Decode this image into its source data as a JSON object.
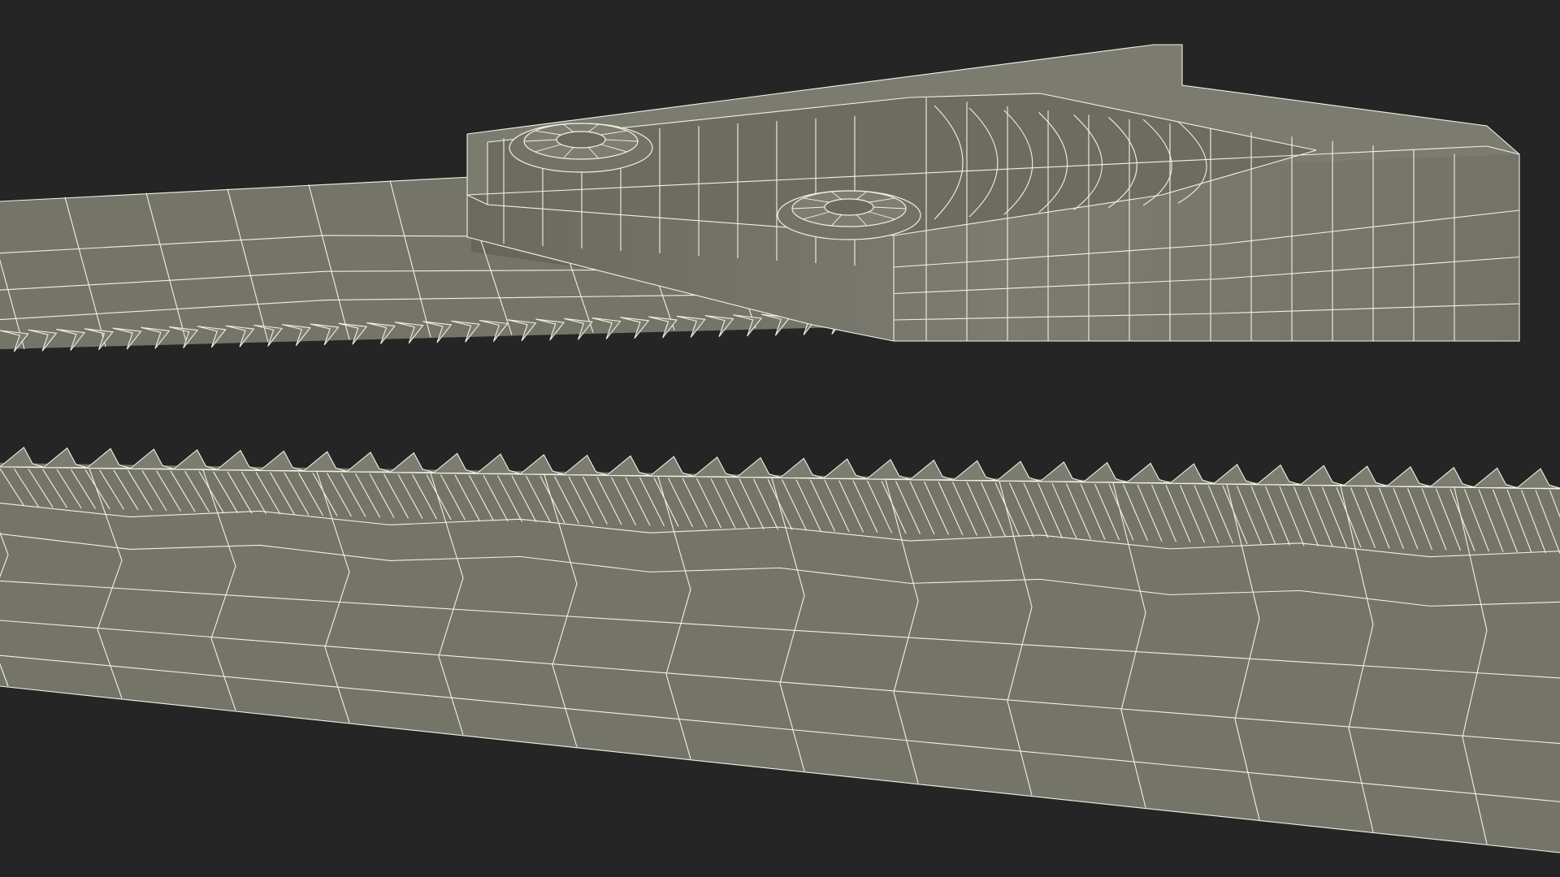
{
  "scene": {
    "subject": "saw-blade-wireframe-render",
    "background_color": "#252525",
    "mesh_fill_color": "#747468",
    "mesh_shadow_color": "#5d5d53",
    "wire_color": "#f1f1e4",
    "upper_blade_tooth_count": 34,
    "lower_blade_tooth_count": 36,
    "handle_bolt_count": 2
  }
}
